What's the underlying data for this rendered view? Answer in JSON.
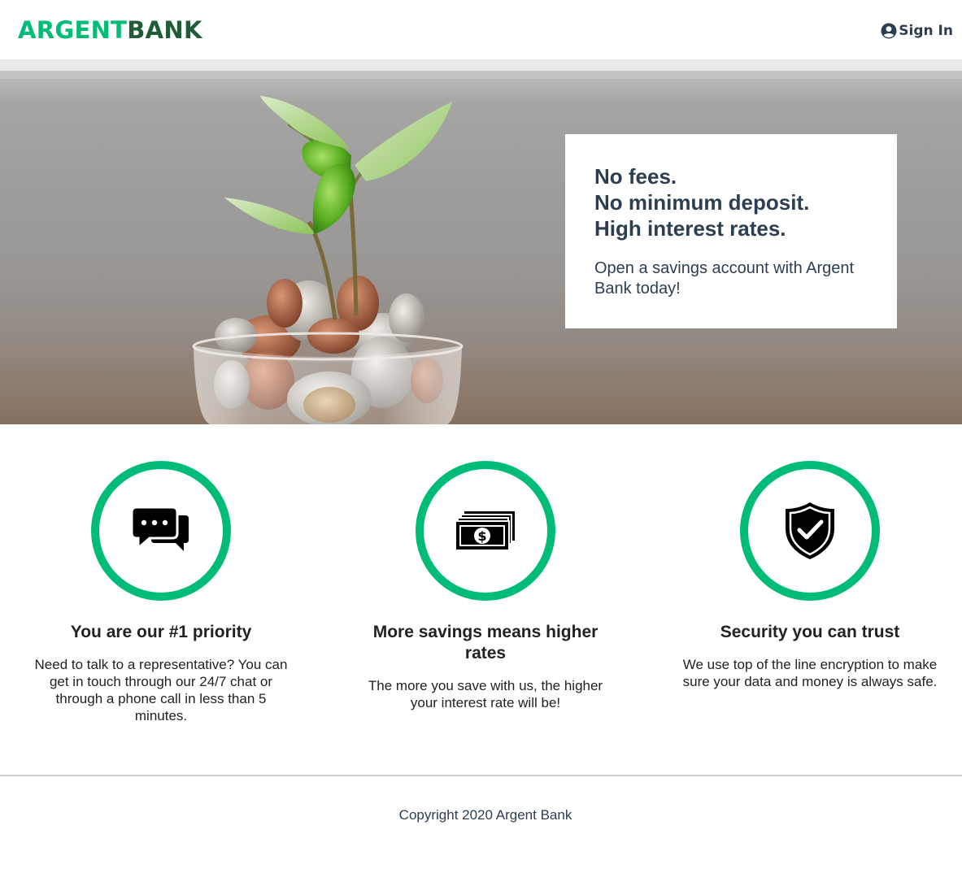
{
  "header": {
    "logo": {
      "part1": "ARGENT",
      "part2": "BANK"
    },
    "signin_label": "Sign In"
  },
  "hero": {
    "subtitles": [
      "No fees.",
      "No minimum deposit.",
      "High interest rates."
    ],
    "text": "Open a savings account with Argent Bank today!"
  },
  "features": [
    {
      "icon": "chat-icon",
      "title": "You are our #1 priority",
      "text": "Need to talk to a representative? You can get in touch through our 24/7 chat or through a phone call in less than 5 minutes."
    },
    {
      "icon": "money-icon",
      "title": "More savings means higher rates",
      "text": "The more you save with us, the higher your interest rate will be!"
    },
    {
      "icon": "security-icon",
      "title": "Security you can trust",
      "text": "We use top of the line encryption to make sure your data and money is always safe."
    }
  ],
  "footer": {
    "copyright": "Copyright 2020 Argent Bank"
  },
  "colors": {
    "accent": "#00bc77",
    "logo_dark": "#1f5c37",
    "text": "#2c3e50",
    "divider": "#cccccc"
  }
}
